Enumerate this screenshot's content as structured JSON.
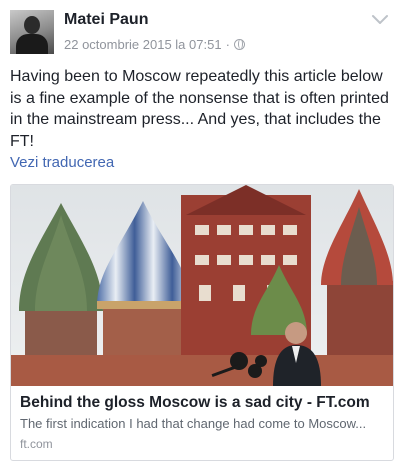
{
  "post": {
    "author": "Matei Paun",
    "timestamp": "22 octombrie 2015 la 07:51",
    "separator": "·",
    "privacy_icon": "globe-icon",
    "menu_icon": "chevron-down-icon",
    "text": "Having been to Moscow repeatedly this article below is a fine example of the nonsense that is often printed in the mainstream press... And yes, that includes the FT!",
    "translate_label": "Vezi traducerea"
  },
  "link_card": {
    "image_subject": "St. Basil's Cathedral domes with speaker at microphones",
    "title": "Behind the gloss Moscow is a sad city - FT.com",
    "description": "The first indication I had that change had come to Moscow...",
    "domain": "ft.com"
  },
  "colors": {
    "link_blue": "#4267b2",
    "meta_grey": "#90949c",
    "text_dark": "#1d2129"
  }
}
